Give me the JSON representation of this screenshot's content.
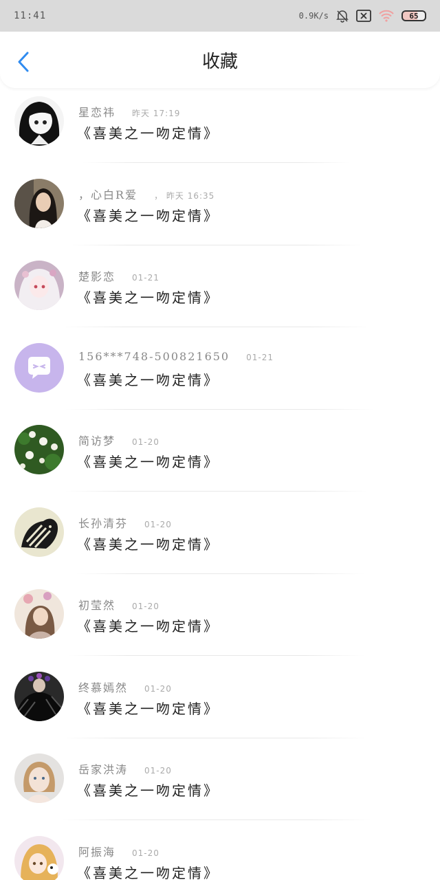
{
  "status_bar": {
    "time": "11:41",
    "net_speed": "0.9K/s",
    "battery": "65",
    "icons": [
      "mute-bell-icon",
      "sim-x-icon",
      "wifi-icon",
      "battery-icon"
    ]
  },
  "header": {
    "title": "收藏",
    "back_icon": "chevron-left-icon",
    "accent_color": "#2f8bf0"
  },
  "items": [
    {
      "author": "星恋祎",
      "time": "昨天 17:19",
      "title": "《喜美之一吻定情》",
      "avatar": "anime-girl-bw"
    },
    {
      "author": "，心白R爱",
      "time": "， 昨天 16:35",
      "title": "《喜美之一吻定情》",
      "avatar": "girl-photo"
    },
    {
      "author": "楚影恋",
      "time": "01-21",
      "title": "《喜美之一吻定情》",
      "avatar": "anime-white-hair"
    },
    {
      "author": "156***748-500821650",
      "time": "01-21",
      "title": "《喜美之一吻定情》",
      "avatar": "default-chat-icon"
    },
    {
      "author": "简访梦",
      "time": "01-20",
      "title": "《喜美之一吻定情》",
      "avatar": "flowers"
    },
    {
      "author": "长孙清芬",
      "time": "01-20",
      "title": "《喜美之一吻定情》",
      "avatar": "zebra"
    },
    {
      "author": "初莹然",
      "time": "01-20",
      "title": "《喜美之一吻定情》",
      "avatar": "floral-lady"
    },
    {
      "author": "终慕嫣然",
      "time": "01-20",
      "title": "《喜美之一吻定情》",
      "avatar": "black-feathers"
    },
    {
      "author": "岳家洪涛",
      "time": "01-20",
      "title": "《喜美之一吻定情》",
      "avatar": "child-photo"
    },
    {
      "author": "阿振海",
      "time": "01-20",
      "title": "《喜美之一吻定情》",
      "avatar": "anime-blonde"
    }
  ]
}
